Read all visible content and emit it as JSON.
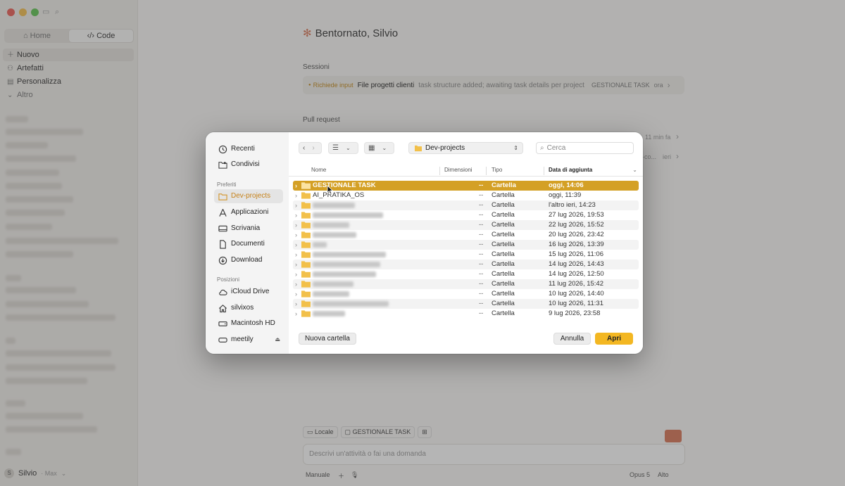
{
  "sidebar": {
    "tabs": [
      {
        "label": "Home"
      },
      {
        "label": "Code"
      }
    ],
    "items": [
      {
        "label": "Nuovo",
        "icon": "plus-icon"
      },
      {
        "label": "Artefatti",
        "icon": "artifacts-icon"
      },
      {
        "label": "Personalizza",
        "icon": "customize-icon"
      },
      {
        "label": "Altro",
        "icon": "chevron-down-icon"
      }
    ],
    "user": {
      "initial": "S",
      "name": "Silvio",
      "plan": "· Max"
    }
  },
  "main": {
    "greeting": "Bentornato, Silvio",
    "sessions_label": "Sessioni",
    "session": {
      "badge": "Richiede input",
      "title": "File progetti clienti",
      "description": "task structure added; awaiting task details per project",
      "project": "GESTIONALE TASK",
      "time": "ora"
    },
    "pull_request_label": "Pull request",
    "pr_rows": [
      {
        "time": "11 min fa"
      },
      {
        "time": "ieri",
        "snippet": "-co..."
      }
    ],
    "chips": {
      "local": "Locale",
      "project": "GESTIONALE TASK"
    },
    "prompt_placeholder": "Descrivi un'attività o fai una domanda",
    "footer": {
      "mode": "Manuale",
      "model": "Opus 5",
      "effort": "Alto"
    }
  },
  "dialog": {
    "sidebar": {
      "top": [
        {
          "label": "Recenti",
          "icon": "clock-icon"
        },
        {
          "label": "Condivisi",
          "icon": "shared-folder-icon"
        }
      ],
      "favorites_label": "Preferiti",
      "favorites": [
        {
          "label": "Dev-projects",
          "icon": "folder-icon",
          "selected": true
        },
        {
          "label": "Applicazioni",
          "icon": "applications-icon"
        },
        {
          "label": "Scrivania",
          "icon": "desktop-icon"
        },
        {
          "label": "Documenti",
          "icon": "document-icon"
        },
        {
          "label": "Download",
          "icon": "download-icon"
        }
      ],
      "locations_label": "Posizioni",
      "locations": [
        {
          "label": "iCloud Drive",
          "icon": "cloud-icon"
        },
        {
          "label": "silvixos",
          "icon": "home-icon"
        },
        {
          "label": "Macintosh HD",
          "icon": "disk-icon"
        },
        {
          "label": "meetily",
          "icon": "external-disk-icon",
          "ejectable": true
        }
      ]
    },
    "toolbar": {
      "path": "Dev-projects",
      "search_placeholder": "Cerca"
    },
    "columns": {
      "name": "Nome",
      "size": "Dimensioni",
      "type": "Tipo",
      "date": "Data di aggiunta"
    },
    "rows": [
      {
        "name": "GESTIONALE TASK",
        "size": "--",
        "type": "Cartella",
        "date": "oggi, 14:06",
        "selected": true
      },
      {
        "name": "AI_PRATIKA_OS",
        "size": "--",
        "type": "Cartella",
        "date": "oggi, 11:39"
      },
      {
        "name": "",
        "size": "--",
        "type": "Cartella",
        "date": "l'altro ieri, 14:23"
      },
      {
        "name": "",
        "size": "--",
        "type": "Cartella",
        "date": "27 lug 2026, 19:53"
      },
      {
        "name": "",
        "size": "--",
        "type": "Cartella",
        "date": "22 lug 2026, 15:52"
      },
      {
        "name": "",
        "size": "--",
        "type": "Cartella",
        "date": "20 lug 2026, 23:42"
      },
      {
        "name": "",
        "size": "--",
        "type": "Cartella",
        "date": "16 lug 2026, 13:39"
      },
      {
        "name": "",
        "size": "--",
        "type": "Cartella",
        "date": "15 lug 2026, 11:06"
      },
      {
        "name": "",
        "size": "--",
        "type": "Cartella",
        "date": "14 lug 2026, 14:43"
      },
      {
        "name": "",
        "size": "--",
        "type": "Cartella",
        "date": "14 lug 2026, 12:50"
      },
      {
        "name": "",
        "size": "--",
        "type": "Cartella",
        "date": "11 lug 2026, 15:42"
      },
      {
        "name": "",
        "size": "--",
        "type": "Cartella",
        "date": "10 lug 2026, 14:40"
      },
      {
        "name": "",
        "size": "--",
        "type": "Cartella",
        "date": "10 lug 2026, 11:31"
      },
      {
        "name": "",
        "size": "--",
        "type": "Cartella",
        "date": "9 lug 2026, 23:58"
      }
    ],
    "buttons": {
      "new_folder": "Nuova cartella",
      "cancel": "Annulla",
      "open": "Apri"
    },
    "colors": {
      "accent": "#f3b722",
      "selection": "#d4a025",
      "folder": "#f2c04a"
    }
  }
}
